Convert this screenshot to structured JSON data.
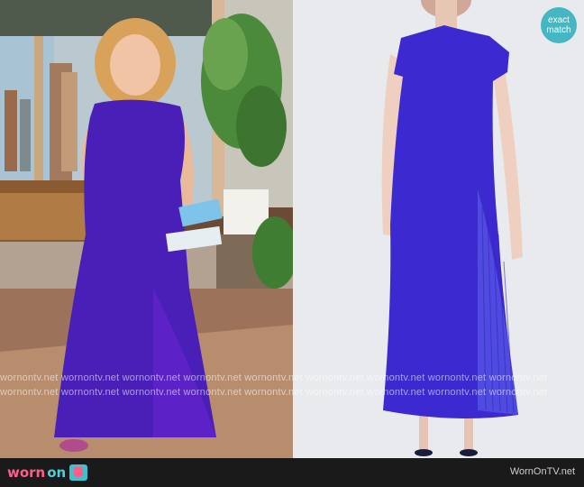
{
  "watermark": {
    "row1": "wornontv.net    wornontv.net    wornontv.net    wornontv.net    wornontv.net    wornontv.net    wornontv.net    wornontv.net    wornontv.net",
    "row2": "wornontv.net    wornontv.net    wornontv.net    wornontv.net    wornontv.net    wornontv.net    wornontv.net    wornontv.net    wornontv.net"
  },
  "badge": {
    "line1": "exact",
    "line2": "match"
  },
  "footer": {
    "logo_word1": "worn",
    "logo_word2": "on",
    "site": "WornOnTV.net"
  },
  "colors": {
    "dress": "#4a1fb8",
    "product_dress": "#3c2ad0",
    "badge": "#45b7c3",
    "footer": "#1a1a1a"
  },
  "icons": {
    "logo": "tv-icon"
  }
}
